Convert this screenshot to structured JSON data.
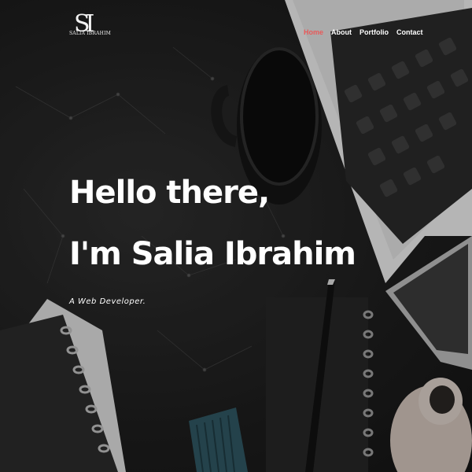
{
  "logo": {
    "mark": "SI",
    "text": "SALIA IBRAHIM"
  },
  "nav": {
    "home": "Home",
    "about": "About",
    "portfolio": "Portfolio",
    "contact": "Contact"
  },
  "hero": {
    "line1": "Hello there,",
    "line2": "I'm Salia Ibrahim",
    "tagline": "A Web Developer."
  },
  "colors": {
    "accent": "#e85a5a",
    "text": "#ffffff",
    "background": "#1e1e1e"
  }
}
